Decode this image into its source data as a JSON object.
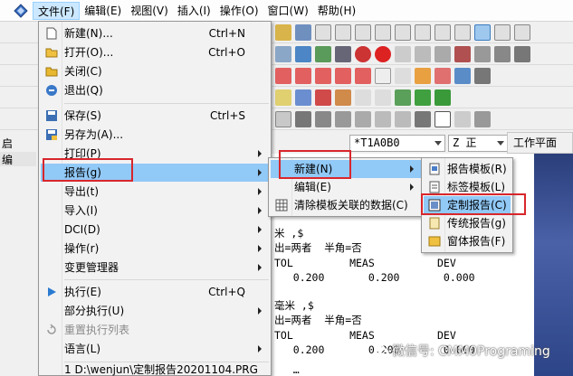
{
  "menubar": {
    "items": [
      "文件(F)",
      "编辑(E)",
      "视图(V)",
      "插入(I)",
      "操作(O)",
      "窗口(W)",
      "帮助(H)"
    ]
  },
  "toolbar": {
    "combo_units": "*T1A0B0",
    "combo_view": "Z 正",
    "workplane_label": "工作平面",
    "left_labels": [
      "启",
      "编"
    ]
  },
  "file_menu": {
    "items": [
      {
        "label": "新建(N)...",
        "shortcut": "Ctrl+N",
        "icon": "new-file-icon"
      },
      {
        "label": "打开(O)...",
        "shortcut": "Ctrl+O",
        "icon": "open-folder-icon"
      },
      {
        "label": "关闭(C)",
        "shortcut": "",
        "icon": "close-folder-icon"
      },
      {
        "label": "退出(Q)",
        "shortcut": "",
        "icon": "exit-icon"
      },
      {
        "label": "保存(S)",
        "shortcut": "Ctrl+S",
        "icon": "save-icon"
      },
      {
        "label": "另存为(A)...",
        "shortcut": "",
        "icon": "save-as-icon"
      },
      {
        "label": "打印(P)",
        "shortcut": "",
        "icon": ""
      },
      {
        "label": "报告(g)",
        "shortcut": "",
        "icon": ""
      },
      {
        "label": "导出(t)",
        "shortcut": "",
        "icon": ""
      },
      {
        "label": "导入(I)",
        "shortcut": "",
        "icon": ""
      },
      {
        "label": "DCI(D)",
        "shortcut": "",
        "icon": ""
      },
      {
        "label": "操作(r)",
        "shortcut": "",
        "icon": ""
      },
      {
        "label": "变更管理器",
        "shortcut": "",
        "icon": ""
      },
      {
        "label": "执行(E)",
        "shortcut": "Ctrl+Q",
        "icon": "execute-icon"
      },
      {
        "label": "部分执行(U)",
        "shortcut": "",
        "icon": ""
      },
      {
        "label": "重置执行列表",
        "shortcut": "",
        "icon": "reset-icon"
      },
      {
        "label": "语言(L)",
        "shortcut": "",
        "icon": ""
      },
      {
        "label": "1 D:\\wenjun\\定制报告20201104.PRG",
        "shortcut": "",
        "icon": ""
      }
    ]
  },
  "report_menu": {
    "items": [
      "新建(N)",
      "编辑(E)",
      "清除模板关联的数据(C)"
    ]
  },
  "new_menu": {
    "items": [
      "报告模板(R)",
      "标签模板(L)",
      "定制报告(C)",
      "传统报告(g)",
      "窗体报告(F)"
    ]
  },
  "editor": {
    "lines": [
      "米 ,$",
      "出=两者  半角=否",
      "TOL         MEAS          DEV",
      "   0.200       0.200       0.000",
      "毫米 ,$",
      "出=两者  半角=否",
      "TOL         MEAS          DEV",
      "   0.200       0.200       0.000",
      "   …"
    ]
  },
  "watermark": "微信号: CMM0Programing",
  "colors": {
    "highlight": "#91c9f7",
    "annotation_red": "#d8262c",
    "menu_bg": "#f2f2f2"
  }
}
